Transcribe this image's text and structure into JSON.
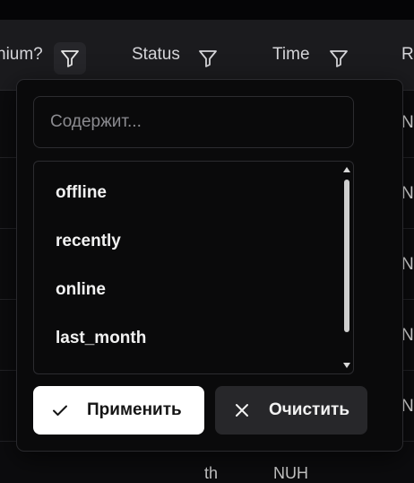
{
  "table": {
    "columns": [
      {
        "label": "nium?",
        "filter_icon": "filter-icon"
      },
      {
        "label": "Status",
        "filter_icon": "filter-icon"
      },
      {
        "label": "Time",
        "filter_icon": "filter-icon"
      },
      {
        "label": "Re"
      }
    ],
    "row_fragments": [
      "N",
      "N",
      "N",
      "N",
      "N"
    ],
    "bottom_fragments": [
      "th",
      "NUH"
    ]
  },
  "filter_popover": {
    "search": {
      "placeholder": "Содержит...",
      "value": ""
    },
    "options": [
      "offline",
      "recently",
      "online",
      "last_month"
    ],
    "apply_label": "Применить",
    "clear_label": "Очистить"
  },
  "colors": {
    "background": "#0c0c0e",
    "header_bg": "#1b1b1e",
    "popover_bg": "#0a0a0b",
    "apply_bg": "#ffffff",
    "clear_bg": "#27272a"
  }
}
